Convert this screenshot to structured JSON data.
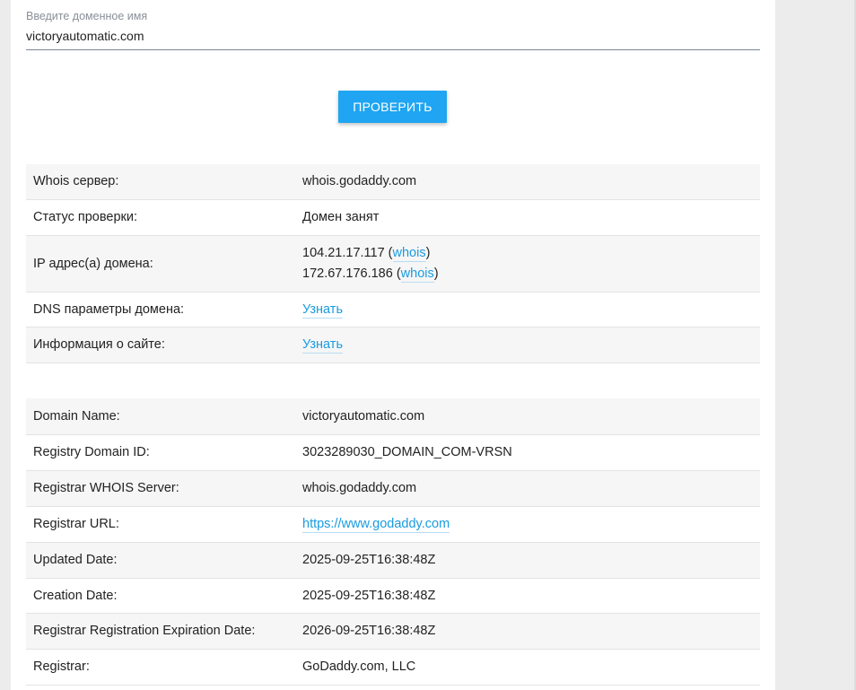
{
  "form": {
    "label": "Введите доменное имя",
    "value": "victoryautomatic.com",
    "button": "ПРОВЕРИТЬ"
  },
  "summary": {
    "whois_server": {
      "key": "Whois сервер:",
      "value": "whois.godaddy.com"
    },
    "status": {
      "key": "Статус проверки:",
      "value": "Домен занят"
    },
    "ips": {
      "key": "IP адрес(а) домена:",
      "items": [
        {
          "ip": "104.21.17.117",
          "link": "whois"
        },
        {
          "ip": "172.67.176.186",
          "link": "whois"
        }
      ]
    },
    "dns": {
      "key": "DNS параметры домена:",
      "link": "Узнать"
    },
    "site": {
      "key": "Информация о сайте:",
      "link": "Узнать"
    }
  },
  "whois": [
    {
      "key": "Domain Name:",
      "value": "victoryautomatic.com"
    },
    {
      "key": "Registry Domain ID:",
      "value": "3023289030_DOMAIN_COM-VRSN"
    },
    {
      "key": "Registrar WHOIS Server:",
      "value": "whois.godaddy.com"
    },
    {
      "key": "Registrar URL:",
      "value": "https://www.godaddy.com"
    },
    {
      "key": "Updated Date:",
      "value": "2025-09-25T16:38:48Z"
    },
    {
      "key": "Creation Date:",
      "value": "2025-09-25T16:38:48Z"
    },
    {
      "key": "Registrar Registration Expiration Date:",
      "value": "2026-09-25T16:38:48Z"
    },
    {
      "key": "Registrar:",
      "value": "GoDaddy.com, LLC"
    }
  ],
  "colors": {
    "accent": "#1fa5f2",
    "link": "#1a9be0"
  }
}
